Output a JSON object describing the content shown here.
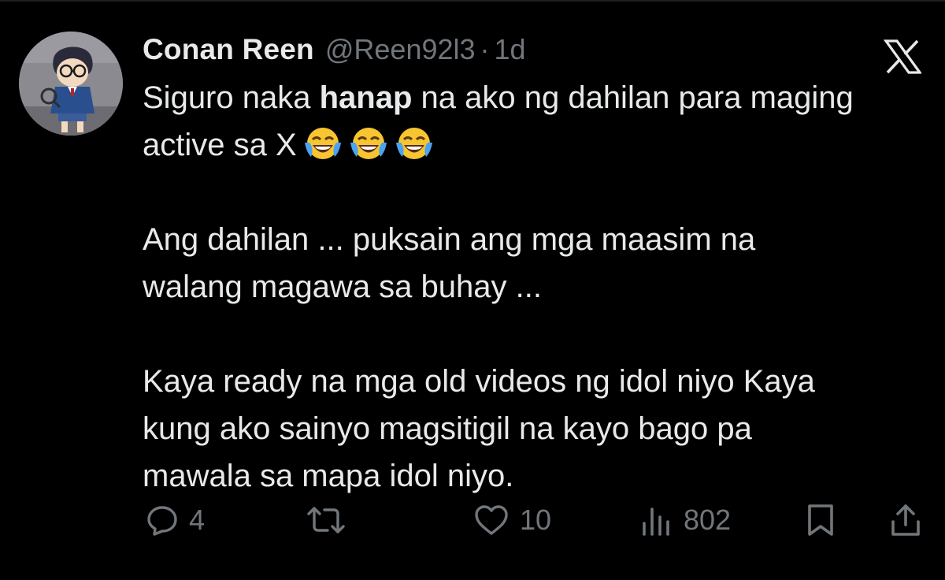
{
  "tweet": {
    "author": {
      "display_name": "Conan Reen",
      "handle": "@Reen92l3",
      "separator": "·",
      "time": "1d"
    },
    "paragraphs": [
      {
        "lines": [
          {
            "before": "Siguro naka ",
            "bold": "hanap",
            "after": " na ako ng dahilan para maging"
          },
          {
            "text": "active sa X"
          }
        ],
        "emojis": [
          "face-with-tears-of-joy",
          "face-with-tears-of-joy",
          "face-with-tears-of-joy"
        ]
      },
      {
        "lines": [
          {
            "text": "Ang dahilan ... puksain ang mga maasim na"
          },
          {
            "text": "walang magawa sa buhay ..."
          }
        ]
      },
      {
        "lines": [
          {
            "text": "Kaya ready na mga old videos ng idol niyo Kaya"
          },
          {
            "text": "kung ako sainyo magsitigil na kayo bago pa"
          },
          {
            "text": "mawala sa mapa idol niyo."
          }
        ]
      }
    ],
    "metrics": {
      "replies": "4",
      "reposts": "",
      "likes": "10",
      "views": "802"
    }
  },
  "icons": {
    "platform": "x-logo-icon",
    "reply": "reply-icon",
    "repost": "repost-icon",
    "like": "heart-icon",
    "views": "views-icon",
    "bookmark": "bookmark-icon",
    "share": "share-icon"
  },
  "colors": {
    "background": "#000000",
    "text_primary": "#e7e9ea",
    "text_secondary": "#71767b"
  }
}
